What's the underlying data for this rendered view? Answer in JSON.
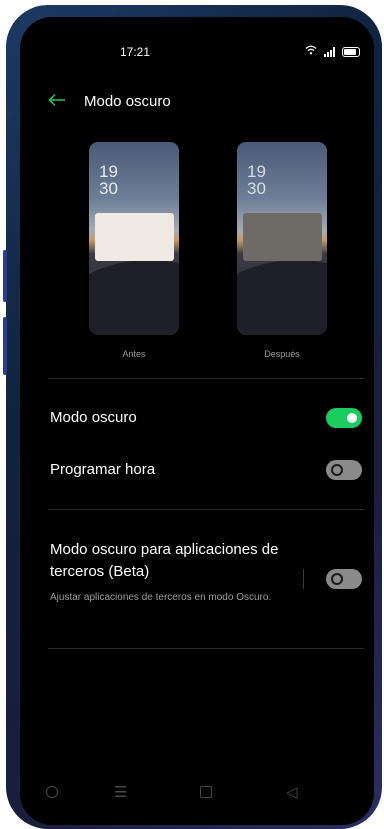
{
  "status_bar": {
    "time": "17:21"
  },
  "header": {
    "title": "Modo oscuro"
  },
  "preview": {
    "before": {
      "clock_hour": "19",
      "clock_minute": "30",
      "label": "Antes"
    },
    "after": {
      "clock_hour": "19",
      "clock_minute": "30",
      "label": "Después"
    }
  },
  "settings": {
    "dark_mode": {
      "label": "Modo oscuro",
      "enabled": true
    },
    "schedule": {
      "label": "Programar hora",
      "enabled": false
    },
    "third_party": {
      "label": "Modo oscuro para aplicaciones de terceros (Beta)",
      "description": "Ajustar aplicaciones de terceros en modo Oscuro.",
      "enabled": false
    }
  },
  "colors": {
    "accent": "#1dcc61",
    "background": "#000000"
  }
}
